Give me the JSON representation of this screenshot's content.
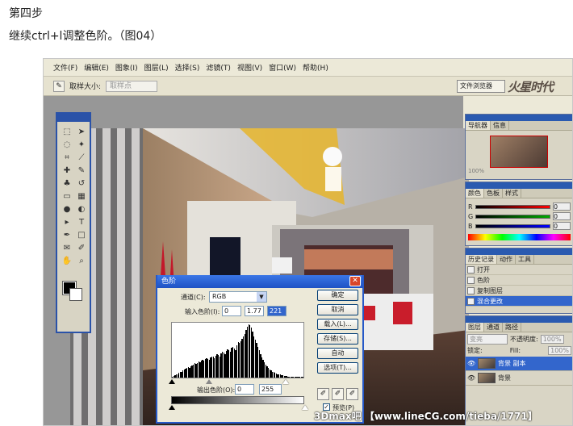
{
  "heading": "第四步",
  "description": "继续ctrl+l调整色阶。（图04）",
  "app": {
    "menu": [
      "文件(F)",
      "编辑(E)",
      "图象(I)",
      "图层(L)",
      "选择(S)",
      "滤镜(T)",
      "视图(V)",
      "窗口(W)",
      "帮助(H)"
    ],
    "options": {
      "sample_label": "取样大小:",
      "sample_value": "取样点"
    },
    "brush_button": "文件浏览器",
    "logo_text": "火星时代",
    "colors": {
      "title_blue": "#2a5ab0",
      "selection_blue": "#3366cc",
      "dialog_face": "#ece9d8"
    }
  },
  "panels": {
    "navigator": {
      "tabs": [
        "导航器",
        "信息"
      ],
      "zoom": "100%"
    },
    "color": {
      "tabs": [
        "颜色",
        "色板",
        "样式"
      ],
      "channels": [
        "R",
        "G",
        "B"
      ],
      "values": [
        "0",
        "0",
        "0"
      ]
    },
    "history": {
      "tabs": [
        "历史记录",
        "动作",
        "工具"
      ],
      "items": [
        "打开",
        "色阶",
        "复制图层",
        "混合更改"
      ]
    },
    "layers": {
      "tabs": [
        "图层",
        "通道",
        "路径"
      ],
      "blend_mode": "变亮",
      "opacity_label": "不透明度:",
      "opacity_value": "100%",
      "lock_label": "锁定:",
      "fill_label": "Fill:",
      "fill_value": "100%",
      "items": [
        "背景 副本",
        "背景"
      ]
    }
  },
  "levels_dialog": {
    "title": "色阶",
    "channel_label": "通道(C):",
    "channel_value": "RGB",
    "input_label": "输入色阶(I):",
    "input_values": [
      "0",
      "1.77",
      "221"
    ],
    "output_label": "输出色阶(O):",
    "output_values": [
      "0",
      "255"
    ],
    "buttons": [
      "确定",
      "取消",
      "载入(L)...",
      "存储(S)...",
      "自动",
      "选项(T)..."
    ],
    "preview_label": "预览(P)",
    "preview_checked": true,
    "histogram": [
      2,
      3,
      4,
      5,
      6,
      8,
      9,
      10,
      12,
      14,
      15,
      16,
      18,
      17,
      19,
      20,
      22,
      24,
      23,
      25,
      27,
      26,
      28,
      30,
      29,
      31,
      33,
      32,
      30,
      34,
      36,
      35,
      33,
      37,
      40,
      38,
      36,
      41,
      44,
      42,
      39,
      45,
      48,
      46,
      43,
      50,
      52,
      49,
      47,
      55,
      60,
      58,
      62,
      66,
      70,
      74,
      80,
      86,
      90,
      88,
      84,
      78,
      70,
      64,
      58,
      52,
      46,
      40,
      34,
      30,
      26,
      22,
      19,
      16,
      14,
      12,
      10,
      9,
      8,
      7,
      6,
      5,
      5,
      4,
      4,
      3,
      3,
      3,
      2,
      2,
      2,
      2,
      1,
      1,
      1,
      1,
      1,
      1,
      1,
      1
    ]
  },
  "watermark": "3Dmax吧 【www.lineCG.com/tieba/1771】"
}
